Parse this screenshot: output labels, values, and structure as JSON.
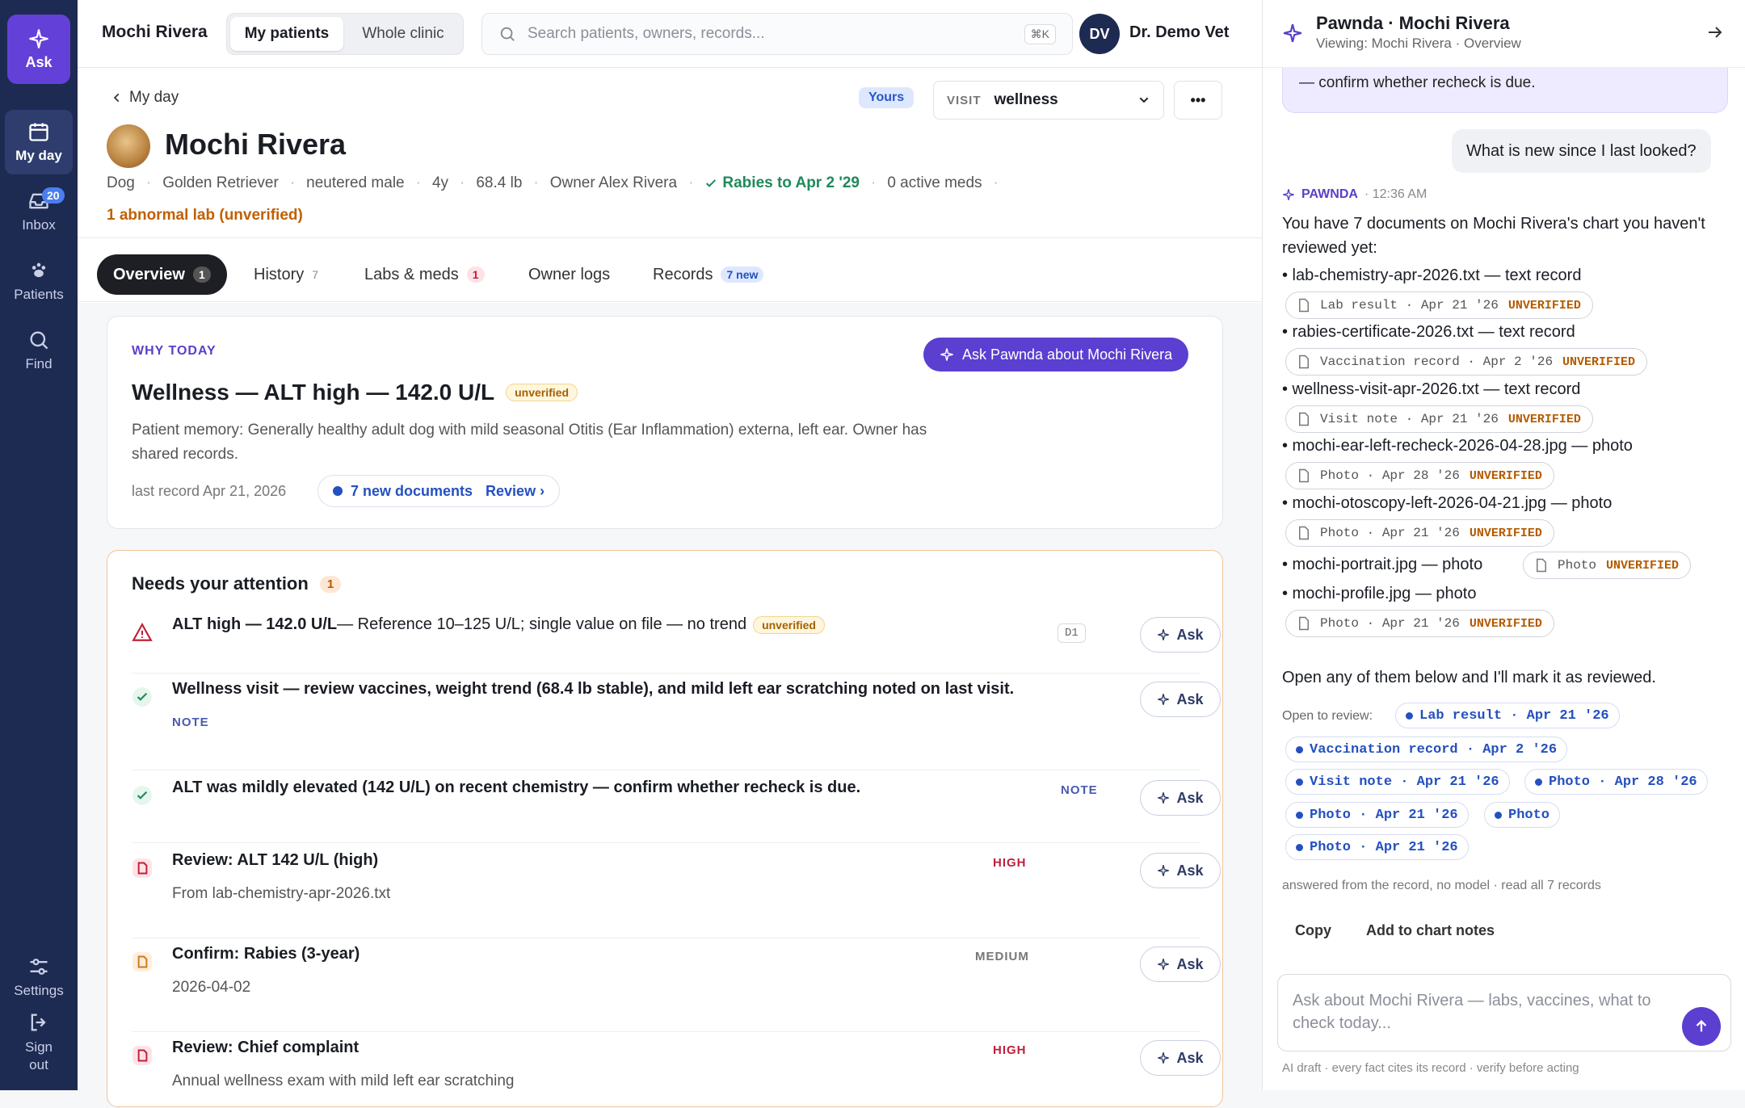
{
  "sidebar": {
    "ask_label": "Ask",
    "items": [
      {
        "label": "My day",
        "icon": "calendar-icon"
      },
      {
        "label": "Inbox",
        "icon": "inbox-icon",
        "badge": "20"
      },
      {
        "label": "Patients",
        "icon": "paw-icon"
      },
      {
        "label": "Find",
        "icon": "search-icon"
      }
    ],
    "settings_label": "Settings",
    "signout_label": "Sign out"
  },
  "topbar": {
    "title": "Mochi Rivera",
    "seg": [
      "My patients",
      "Whole clinic"
    ],
    "search_placeholder": "Search patients, owners, records...",
    "shortcut": "⌘K",
    "avatar": "DV",
    "user": "Dr. Demo Vet"
  },
  "header": {
    "back": "My day",
    "yours": "Yours",
    "visit_label": "VISIT",
    "visit_value": "wellness",
    "more": "•••",
    "name": "Mochi Rivera",
    "meta": [
      "Dog",
      "Golden Retriever",
      "neutered male",
      "4y",
      "68.4 lb",
      "Owner Alex Rivera"
    ],
    "rabies": "Rabies to Apr 2 '29",
    "meds": "0 active meds",
    "abnormal": "1 abnormal lab (unverified)"
  },
  "tabs": [
    {
      "label": "Overview",
      "count": "1"
    },
    {
      "label": "History",
      "count": "7"
    },
    {
      "label": "Labs & meds",
      "count": "1"
    },
    {
      "label": "Owner logs",
      "count": ""
    },
    {
      "label": "Records",
      "count": "7 new"
    }
  ],
  "why": {
    "label": "WHY TODAY",
    "ask": "Ask Pawnda about Mochi Rivera",
    "title": "Wellness — ALT high — 142.0 U/L",
    "badge": "unverified",
    "desc": "Patient memory: Generally healthy adult dog with mild seasonal Otitis (Ear Inflammation) externa, left ear. Owner has shared records.",
    "last": "last record Apr 21, 2026",
    "newdocs": "7 new documents",
    "review": "Review ›"
  },
  "attention": {
    "title": "Needs your attention",
    "count": "1",
    "ask": "Ask",
    "rows": [
      {
        "bold": "ALT high — 142.0 U/L",
        "rest": " — Reference 10–125 U/L; single value on file — no trend",
        "badge": "unverified",
        "code": "D1"
      },
      {
        "bold": "Wellness visit — review vaccines, weight trend (68.4 lb stable), and mild left ear scratching noted on last visit.",
        "tag": "NOTE"
      },
      {
        "bold": "ALT was mildly elevated (142 U/L) on recent chemistry — confirm whether recheck is due.",
        "tag": "NOTE"
      },
      {
        "bold": "Review: ALT 142 U/L (high)",
        "sub": "From lab-chemistry-apr-2026.txt",
        "tag": "HIGH"
      },
      {
        "bold": "Confirm: Rabies (3-year)",
        "sub": "2026-04-02",
        "tag": "MEDIUM"
      },
      {
        "bold": "Review: Chief complaint",
        "sub": "Annual wellness exam with mild left ear scratching",
        "tag": "HIGH"
      }
    ]
  },
  "panel": {
    "title": "Pawnda · Mochi Rivera",
    "sub": "Viewing: Mochi Rivera · Overview",
    "prev": "— confirm whether recheck is due.",
    "user_msg": "What is new since I last looked?",
    "bot": "PAWNDA",
    "time": "· 12:36 AM",
    "intro": "You have 7 documents on Mochi Rivera's chart you haven't reviewed yet:",
    "docs": [
      {
        "line": "• lab-chemistry-apr-2026.txt — text record",
        "chip": "Lab result · Apr 21 '26"
      },
      {
        "line": "• rabies-certificate-2026.txt — text record",
        "chip": "Vaccination record · Apr 2 '26"
      },
      {
        "line": "• wellness-visit-apr-2026.txt — text record",
        "chip": "Visit note · Apr 21 '26"
      },
      {
        "line": "• mochi-ear-left-recheck-2026-04-28.jpg — photo",
        "chip": "Photo · Apr 28 '26"
      },
      {
        "line": "• mochi-otoscopy-left-2026-04-21.jpg — photo",
        "chip": "Photo · Apr 21 '26"
      },
      {
        "line": "• mochi-portrait.jpg — photo",
        "chip": "Photo"
      },
      {
        "line": "• mochi-profile.jpg — photo",
        "chip": "Photo · Apr 21 '26"
      }
    ],
    "unverified": "UNVERIFIED",
    "outro": "Open any of them below and I'll mark it as reviewed.",
    "open_label": "Open to review:",
    "pills": [
      "Lab result · Apr 21 '26",
      "Vaccination record · Apr 2 '26",
      "Visit note · Apr 21 '26",
      "Photo · Apr 28 '26",
      "Photo · Apr 21 '26",
      "Photo",
      "Photo · Apr 21 '26"
    ],
    "answered": "answered from the record, no model · read all 7 records",
    "copy": "Copy",
    "add": "Add to chart notes",
    "placeholder": "Ask about Mochi Rivera — labs, vaccines, what to check today...",
    "footer": "AI draft · every fact cites its record · verify before acting"
  }
}
